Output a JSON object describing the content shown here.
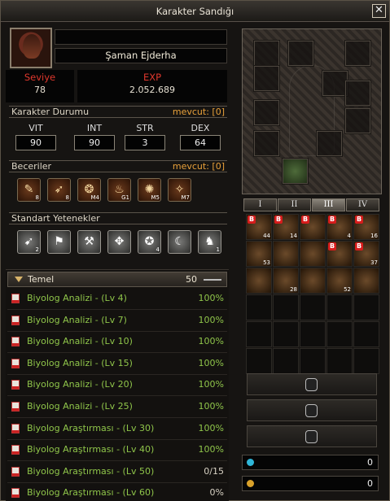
{
  "window": {
    "title": "Karakter Sandığı",
    "close_label": "✕"
  },
  "character": {
    "name_top": "",
    "name": "Şaman Ejderha",
    "level_label": "Seviye",
    "level": "78",
    "exp_label": "EXP",
    "exp": "2.052.689"
  },
  "status": {
    "title": "Karakter Durumu",
    "available_label": "mevcut:",
    "available_value": "[0]",
    "attrs": [
      {
        "label": "VIT",
        "value": "90"
      },
      {
        "label": "INT",
        "value": "90"
      },
      {
        "label": "STR",
        "value": "3"
      },
      {
        "label": "DEX",
        "value": "64"
      }
    ]
  },
  "skills": {
    "title": "Beceriler",
    "available_label": "mevcut:",
    "available_value": "[0]",
    "items": [
      {
        "icon": "scroll-icon",
        "glyph": "✎",
        "num": "8"
      },
      {
        "icon": "dragon-icon",
        "glyph": "➶",
        "num": "8"
      },
      {
        "icon": "dragon-roar-icon",
        "glyph": "❂",
        "num": "M4"
      },
      {
        "icon": "lantern-icon",
        "glyph": "♨",
        "num": "G1"
      },
      {
        "icon": "rune-icon",
        "glyph": "✺",
        "num": "M5"
      },
      {
        "icon": "claw-icon",
        "glyph": "✧",
        "num": "M7"
      }
    ]
  },
  "standard": {
    "title": "Standart Yetenekler",
    "items": [
      {
        "icon": "feather-icon",
        "glyph": "➹",
        "num": "2"
      },
      {
        "icon": "flag-icon",
        "glyph": "⚑",
        "num": ""
      },
      {
        "icon": "pickaxe-icon",
        "glyph": "⚒",
        "num": ""
      },
      {
        "icon": "knot-icon",
        "glyph": "✥",
        "num": ""
      },
      {
        "icon": "seal-icon",
        "glyph": "✪",
        "num": "4"
      },
      {
        "icon": "claw-swipe-icon",
        "glyph": "☾",
        "num": ""
      },
      {
        "icon": "horse-icon",
        "glyph": "♞",
        "num": "1"
      }
    ]
  },
  "quests": {
    "group_label": "Temel",
    "group_count": "50",
    "rows": [
      {
        "name": "Biyolog Analizi - (Lv 4)",
        "pct": "100%"
      },
      {
        "name": "Biyolog Analizi - (Lv 7)",
        "pct": "100%"
      },
      {
        "name": "Biyolog Analizi - (Lv 10)",
        "pct": "100%"
      },
      {
        "name": "Biyolog Analizi - (Lv 15)",
        "pct": "100%"
      },
      {
        "name": "Biyolog Analizi - (Lv 20)",
        "pct": "100%"
      },
      {
        "name": "Biyolog Analizi - (Lv 25)",
        "pct": "100%"
      },
      {
        "name": "Biyolog Araştırması - (Lv 30)",
        "pct": "100%"
      },
      {
        "name": "Biyolog Araştırması - (Lv 40)",
        "pct": "100%"
      },
      {
        "name": "Biyolog Araştırması - (Lv 50)",
        "pct": "0/15"
      },
      {
        "name": "Biyolog Araştırması - (Lv 60)",
        "pct": "0%"
      }
    ]
  },
  "inventory": {
    "tabs": [
      "I",
      "II",
      "III",
      "IV"
    ],
    "active_tab": "III",
    "badges": [
      "B",
      "B",
      "B",
      "B",
      "B",
      "",
      "",
      "",
      "B",
      "B",
      "",
      "",
      "",
      "",
      "",
      "",
      "",
      "",
      "",
      "",
      "",
      "B",
      ""
    ],
    "quantities": [
      "44",
      "14",
      "",
      "4",
      "16",
      "53",
      "",
      "",
      "",
      "37",
      "",
      "28",
      "",
      "52",
      ""
    ],
    "gold": "0",
    "gems": "0"
  },
  "colors": {
    "accent": "#e9a13a",
    "quest_green": "#8fc54a",
    "level_red": "#e0382d"
  }
}
